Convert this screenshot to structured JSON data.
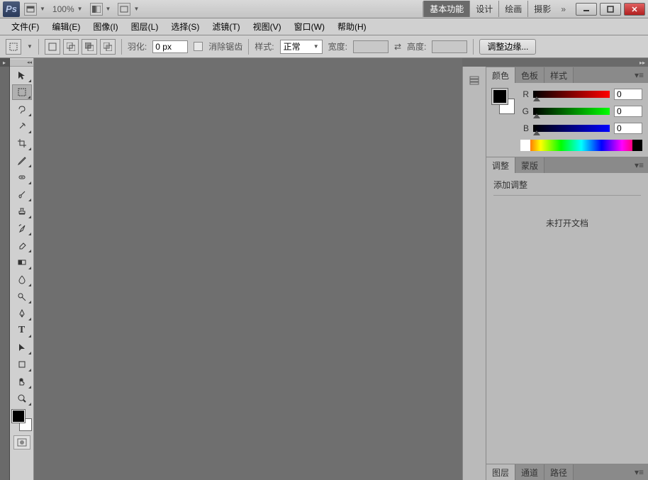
{
  "titlebar": {
    "zoom": "100%",
    "workspaces": [
      "基本功能",
      "设计",
      "绘画",
      "摄影"
    ],
    "workspace_active": 0
  },
  "menu": [
    "文件(F)",
    "编辑(E)",
    "图像(I)",
    "图层(L)",
    "选择(S)",
    "滤镜(T)",
    "视图(V)",
    "窗口(W)",
    "帮助(H)"
  ],
  "optbar": {
    "feather_label": "羽化:",
    "feather_value": "0 px",
    "antialias_label": "消除锯齿",
    "style_label": "样式:",
    "style_value": "正常",
    "width_label": "宽度:",
    "height_label": "高度:",
    "refine_label": "调整边缘..."
  },
  "tools": [
    "move",
    "marquee",
    "lasso",
    "wand",
    "crop",
    "eyedropper",
    "heal",
    "brush",
    "stamp",
    "history-brush",
    "eraser",
    "gradient",
    "blur",
    "dodge",
    "pen",
    "type",
    "path-select",
    "shape",
    "hand",
    "zoom"
  ],
  "color_panel": {
    "tabs": [
      "颜色",
      "色板",
      "样式"
    ],
    "channels": [
      {
        "label": "R",
        "value": "0"
      },
      {
        "label": "G",
        "value": "0"
      },
      {
        "label": "B",
        "value": "0"
      }
    ]
  },
  "adjust_panel": {
    "tabs": [
      "调整",
      "蒙版"
    ],
    "title": "添加调整",
    "message": "未打开文档"
  },
  "layers_panel": {
    "tabs": [
      "图层",
      "通道",
      "路径"
    ]
  }
}
